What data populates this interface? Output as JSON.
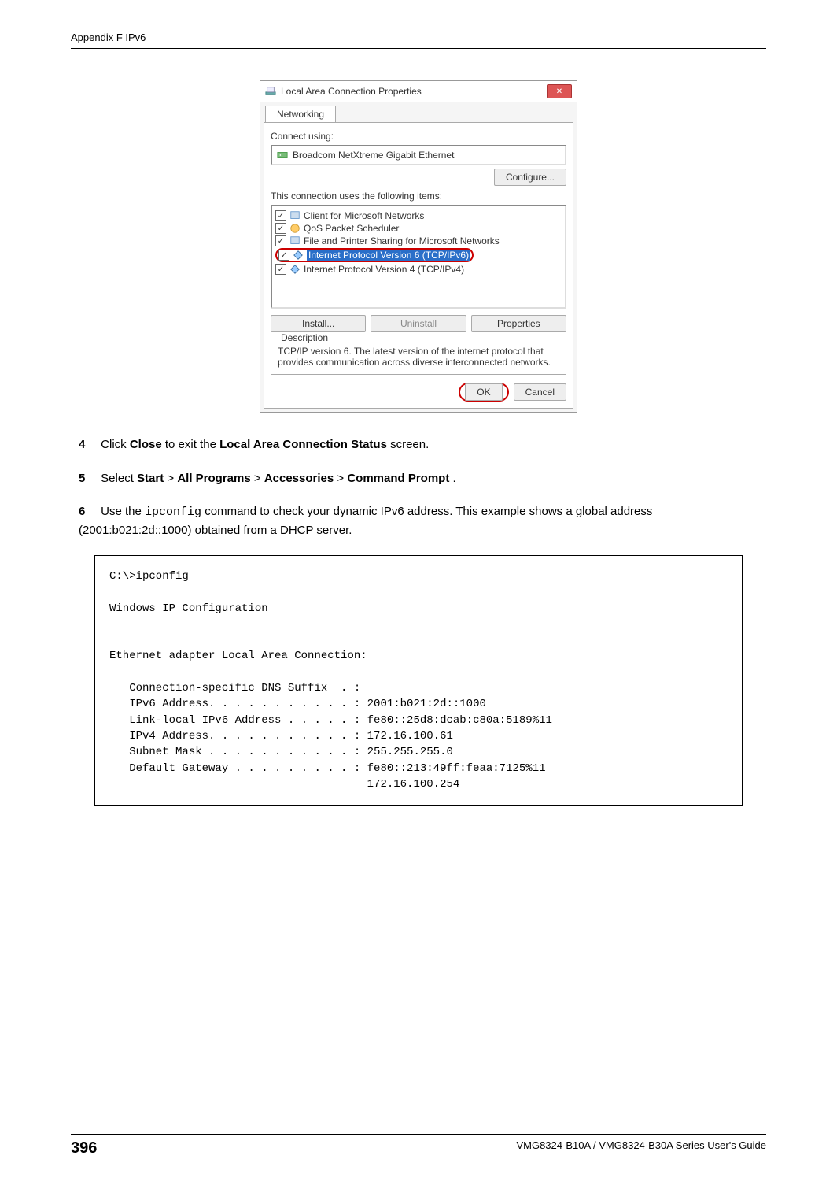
{
  "header": {
    "title": "Appendix F IPv6"
  },
  "screenshot": {
    "window_title": "Local Area Connection Properties",
    "tab": "Networking",
    "connect_using_label": "Connect using:",
    "nic_name": "Broadcom NetXtreme Gigabit Ethernet",
    "configure_btn": "Configure...",
    "items_label": "This connection uses the following items:",
    "items": [
      "Client for Microsoft Networks",
      "QoS Packet Scheduler",
      "File and Printer Sharing for Microsoft Networks",
      "Internet Protocol Version 6 (TCP/IPv6)",
      "Internet Protocol Version 4 (TCP/IPv4)"
    ],
    "install_btn": "Install...",
    "uninstall_btn": "Uninstall",
    "properties_btn": "Properties",
    "description_label": "Description",
    "description_text": "TCP/IP version 6. The latest version of the internet protocol that provides communication across diverse interconnected networks.",
    "ok_btn": "OK",
    "cancel_btn": "Cancel"
  },
  "steps": {
    "s4": {
      "num": "4",
      "pre": "Click ",
      "close": "Close",
      "mid": " to exit the ",
      "screen": "Local Area Connection Status",
      "post": " screen."
    },
    "s5": {
      "num": "5",
      "pre": "Select ",
      "start": "Start",
      "gt1": " > ",
      "allprograms": "All Programs",
      "gt2": " > ",
      "accessories": "Accessories",
      "gt3": " > ",
      "cmd": "Command Prompt",
      "post": "."
    },
    "s6": {
      "num": "6",
      "pre": "Use the ",
      "cmd": "ipconfig",
      "post": " command to check your dynamic IPv6 address. This example shows a global address (2001:b021:2d::1000) obtained from a DHCP server."
    }
  },
  "console": "C:\\>ipconfig\n\nWindows IP Configuration\n\n\nEthernet adapter Local Area Connection:\n\n   Connection-specific DNS Suffix  . :\n   IPv6 Address. . . . . . . . . . . : 2001:b021:2d::1000\n   Link-local IPv6 Address . . . . . : fe80::25d8:dcab:c80a:5189%11\n   IPv4 Address. . . . . . . . . . . : 172.16.100.61\n   Subnet Mask . . . . . . . . . . . : 255.255.255.0\n   Default Gateway . . . . . . . . . : fe80::213:49ff:feaa:7125%11\n                                       172.16.100.254",
  "footer": {
    "page_num": "396",
    "guide": "VMG8324-B10A / VMG8324-B30A Series User's Guide"
  }
}
